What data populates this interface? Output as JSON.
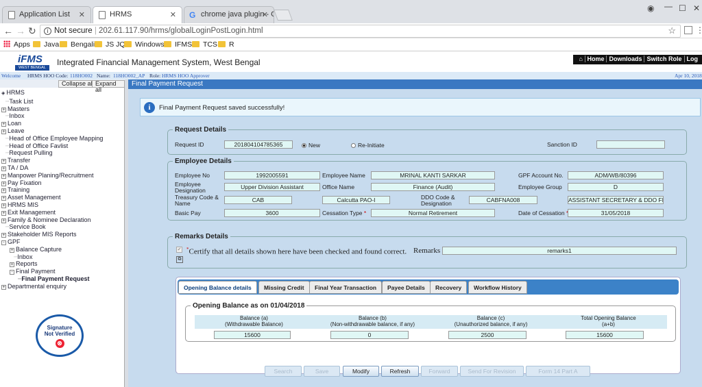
{
  "browser": {
    "tabs": [
      {
        "label": "Application List"
      },
      {
        "label": "HRMS"
      },
      {
        "label": "chrome java plugin - Goo"
      }
    ],
    "address": {
      "security": "Not secure",
      "url": "202.61.117.90/hrms/globalLoginPostLogin.html"
    },
    "bookmarks": [
      "Apps",
      "Java",
      "Bengali",
      "JS JQ",
      "Windows",
      "IFMS",
      "TCS",
      "R"
    ]
  },
  "header": {
    "logo_main": "iFMS",
    "logo_sub": "WEST BENGAL",
    "title": "Integrated Financial Management System, West Bengal",
    "links": [
      "Home",
      "Downloads",
      "Switch Role",
      "Log"
    ]
  },
  "welcome": {
    "welcome": "Welcome",
    "user_label": "HRMS HOO Code:",
    "user_code": "118HO002",
    "name_label": "Name:",
    "name_value": "118HO002_AP",
    "role_label": "Role:",
    "role_value": "HRMS HOO Approver",
    "date": "Apr 10, 2018"
  },
  "sidebar": {
    "collapse_label": "Collapse all",
    "expand_label": "Expand all",
    "tree": [
      {
        "label": "HRMS",
        "level": 0,
        "exp": ""
      },
      {
        "label": "Task List",
        "level": 1,
        "exp": ""
      },
      {
        "label": "Masters",
        "level": 0,
        "exp": "+"
      },
      {
        "label": "Inbox",
        "level": 1,
        "exp": ""
      },
      {
        "label": "Loan",
        "level": 0,
        "exp": "+"
      },
      {
        "label": "Leave",
        "level": 0,
        "exp": "+"
      },
      {
        "label": "Head of Office Employee Mapping",
        "level": 1,
        "exp": ""
      },
      {
        "label": "Head of Office Favlist",
        "level": 1,
        "exp": ""
      },
      {
        "label": "Request Pulling",
        "level": 1,
        "exp": ""
      },
      {
        "label": "Transfer",
        "level": 0,
        "exp": "+"
      },
      {
        "label": "TA / DA",
        "level": 0,
        "exp": "+"
      },
      {
        "label": "Manpower Planing/Recruitment",
        "level": 0,
        "exp": "+"
      },
      {
        "label": "Pay Fixation",
        "level": 0,
        "exp": "+"
      },
      {
        "label": "Training",
        "level": 0,
        "exp": "+"
      },
      {
        "label": "Asset Management",
        "level": 0,
        "exp": "+"
      },
      {
        "label": "HRMS MIS",
        "level": 0,
        "exp": "+"
      },
      {
        "label": "Exit Management",
        "level": 0,
        "exp": "+"
      },
      {
        "label": "Family & Nominee Declaration",
        "level": 0,
        "exp": "+"
      },
      {
        "label": "Service Book",
        "level": 1,
        "exp": ""
      },
      {
        "label": "Stakeholder MIS Reports",
        "level": 0,
        "exp": "+"
      },
      {
        "label": "GPF",
        "level": 0,
        "exp": "-"
      },
      {
        "label": "Balance Capture",
        "level": 2,
        "exp": "+"
      },
      {
        "label": "Inbox",
        "level": 3,
        "exp": ""
      },
      {
        "label": "Reports",
        "level": 2,
        "exp": "+"
      },
      {
        "label": "Final Payment",
        "level": 2,
        "exp": "-"
      },
      {
        "label": "Final Payment Request",
        "level": 4,
        "exp": "",
        "bold": true
      },
      {
        "label": "Departmental enquiry",
        "level": 0,
        "exp": "+"
      }
    ],
    "signature": {
      "line1": "Signature",
      "line2": "Not Verified"
    }
  },
  "page": {
    "title": "Final Payment Request",
    "success": "Final Payment Request saved successfully!",
    "request": {
      "legend": "Request Details",
      "request_id_label": "Request ID",
      "request_id": "201804104785365",
      "radio_new": "New",
      "radio_reinitiate": "Re-Initiate",
      "sanction_id_label": "Sanction ID",
      "sanction_id": ""
    },
    "employee": {
      "legend": "Employee Details",
      "emp_no_label": "Employee No",
      "emp_no": "1992005591",
      "emp_name_label": "Employee Name",
      "emp_name": "MRINAL KANTI SARKAR",
      "gpf_label": "GPF Account No.",
      "gpf": "ADM/WB/80396",
      "designation_label": "Employee Designation",
      "designation": "Upper Division Assistant",
      "office_label": "Office Name",
      "office": "Finance (Audit)",
      "group_label": "Employee Group",
      "group": "D",
      "treasury_label": "Treasury Code & Name",
      "treasury_code": "CAB",
      "treasury_name": "Calcutta PAO-I",
      "ddo_label": "DDO Code & Designation",
      "ddo_code": "CABFNA008",
      "ddo_designation": "ASSISTANT SECRETARY & DDO FIN",
      "basic_label": "Basic Pay",
      "basic": "3600",
      "cessation_type_label": "Cessation Type",
      "cessation_type": "Normal Retirement",
      "cessation_date_label": "Date of Cessation",
      "cessation_date": "31/05/2018",
      "required_mark": "*"
    },
    "remarks": {
      "legend": "Remarks Details",
      "certify": "Certify that all details shown here have been checked and found correct.",
      "remarks_label": "Remarks",
      "remarks": "remarks1"
    },
    "tabs": [
      "Opening Balance details",
      "Missing Credit",
      "Final Year Transaction",
      "Payee Details",
      "Recovery",
      "Workflow History"
    ],
    "opening": {
      "legend": "Opening Balance as on 01/04/2018",
      "headers": [
        {
          "l1": "Balance (a)",
          "l2": "(Withdrawable Balance)"
        },
        {
          "l1": "Balance (b)",
          "l2": "(Non-withdrawable balance, if any)"
        },
        {
          "l1": "Balance (c)",
          "l2": "(Unauthorized balance, if any)"
        },
        {
          "l1": "Total Opening Balance",
          "l2": "(a+b)"
        }
      ],
      "values": [
        "15600",
        "0",
        "2500",
        "15600"
      ]
    },
    "buttons": [
      {
        "label": "Search",
        "enabled": false
      },
      {
        "label": "Save",
        "enabled": false
      },
      {
        "label": "Modify",
        "enabled": true
      },
      {
        "label": "Refresh",
        "enabled": true
      },
      {
        "label": "Forward",
        "enabled": false
      },
      {
        "label": "Send For Revision",
        "enabled": false
      },
      {
        "label": "Form 14 Part A",
        "enabled": false
      }
    ]
  }
}
